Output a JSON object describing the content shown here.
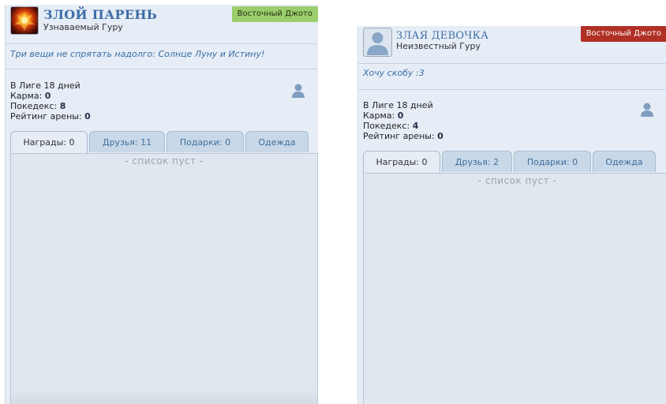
{
  "profiles": [
    {
      "nickname": "ЗЛОЙ ПАРЕНЬ",
      "rank": "Узнаваемый Гуру",
      "team": "Восточный Джото",
      "team_color": "#9ccd6c",
      "avatar": "fire-avatar",
      "status": "Три вещи не спрятать надолго: Солнце Луну и Истину!",
      "stats": {
        "league": "В Лиге 18 дней",
        "karma_label": "Карма:",
        "karma": "0",
        "pokedex_label": "Покедекс:",
        "pokedex": "8",
        "arena_label": "Рейтинг арены:",
        "arena": "0"
      },
      "tabs": [
        "Награды: 0",
        "Друзья: 11",
        "Подарки: 0",
        "Одежда"
      ],
      "empty_text": "- список пуст -"
    },
    {
      "nickname": "ЗЛАЯ ДЕВОЧКА",
      "rank": "Неизвестный Гуру",
      "team": "Восточный Джото",
      "team_color": "#b03024",
      "avatar": "default-user-avatar",
      "status": "Хочу скобу :3",
      "stats": {
        "league": "В Лиге 18 дней",
        "karma_label": "Карма:",
        "karma": "0",
        "pokedex_label": "Покедекс:",
        "pokedex": "4",
        "arena_label": "Рейтинг арены:",
        "arena": "0"
      },
      "tabs": [
        "Награды: 0",
        "Друзья: 2",
        "Подарки: 0",
        "Одежда"
      ],
      "empty_text": "- список пуст -"
    }
  ]
}
